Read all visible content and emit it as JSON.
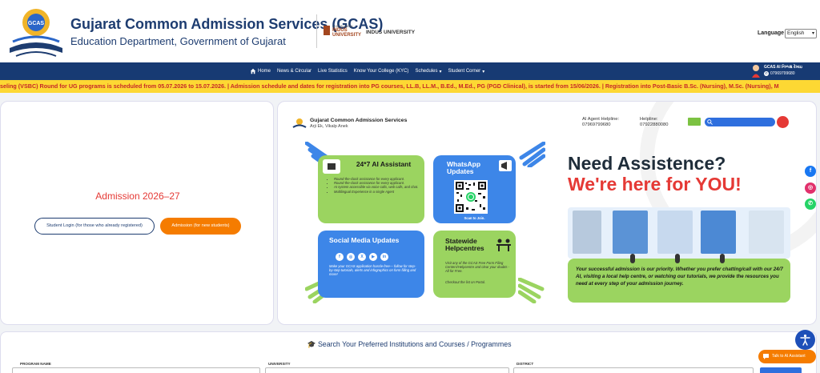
{
  "header": {
    "title": "Gujarat Common Admission Services (GCAS)",
    "subtitle": "Education Department, Government of Gujarat",
    "logo_text": "GCAS",
    "partner_logo_top": "LIVE IN INDIA",
    "partner_logo_name": "INDUS UNIVERSITY",
    "partner_name": "INDUS UNIVERSITY",
    "language_label": "Language :",
    "language_value": "English"
  },
  "nav": {
    "items": [
      "Home",
      "News & Circular",
      "Live Statistics",
      "Know Your College (KYC)",
      "Schedules",
      "Student Corner"
    ],
    "user_name": "GCAS AI નિષ્પક્ષ રેખાઇ",
    "user_phone": "07969799680"
  },
  "ticker": "seling (VSBC) Round for UG programs is scheduled from 05.07.2026 to 15.07.2026. | Admission schedule and dates for registration into PG courses, LL.B, LL.M., B.Ed., M.Ed., PG (PGD Clinical), is started from 15/06/2026. | Registration into Post-Basic B.Sc. (Nursing), M.Sc. (Nursing), M",
  "admission": {
    "title": "Admission 2026–27",
    "student_login": "Student Login (for those who already registered)",
    "new_admission": "Admission (for new students)"
  },
  "banner": {
    "title": "Gujarat Common Admission Services",
    "subtitle": "Arji Ek, Vikalp Anek",
    "ai_helpline_label": "AI Agent Helpline:",
    "ai_helpline": "07969799680",
    "helpline_label": "Helpline:",
    "helpline": "07922880080",
    "tile1_title": "24*7 AI Assistant",
    "tile1_points": [
      "Round-the-clock assistance for every applicant.",
      "Round-the-clock assistance for every applicant.",
      "AI system accessible via voice calls, web calls, and chat.",
      "Multilingual Experience in a single Agent"
    ],
    "tile2_title": "WhatsApp Updates",
    "tile2_caption": "Scan to Join.",
    "tile3_title": "Social Media Updates",
    "tile3_body": "Make your GCAS application hassle-free— follow for step-by-step tutorials, alerts and infographics on form filling and more!",
    "tile4_title": "Statewide Helpcentres",
    "tile4_body": "Visit any of the GCAS Free Form Filing Centers/Helpcentre and clear your doubts - All for Free.",
    "tile4_link": "Checkout the list on Portal.",
    "headline1": "Need Assistence?",
    "headline2": "We're here for YOU!",
    "assist_text": "Your successful admission is our priority. Whether you prefer chatting/call with our 24/7 AI, visiting a local help centre, or watching our tutorials, we provide the resources you need at every step of your admission journey."
  },
  "search": {
    "title": "Search Your Preferred Institutions and Courses / Programmes",
    "program_label": "PROGRAM NAME",
    "university_label": "UNIVERSITY",
    "district_label": "DISTRICT"
  },
  "ai_button": "Talk to AI Assistant",
  "colors": {
    "navy": "#173a73",
    "ticker": "#fdd833",
    "orange": "#f57c00",
    "green": "#9bd460",
    "blue": "#3d86e8",
    "red": "#e53935"
  }
}
